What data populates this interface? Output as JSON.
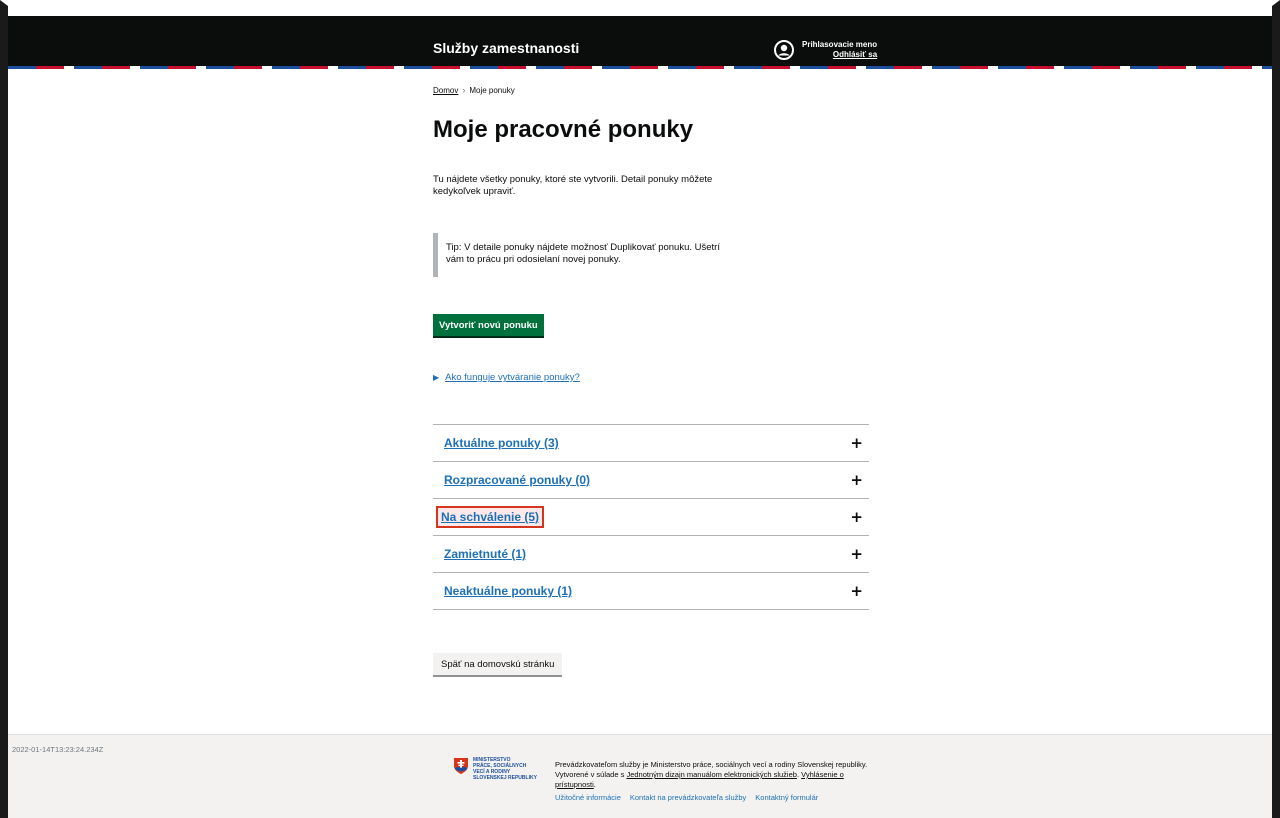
{
  "header": {
    "brand": "Služby zamestnanosti",
    "user_name": "Prihlasovacie meno",
    "logout": "Odhlásiť sa"
  },
  "breadcrumb": {
    "home": "Domov",
    "current": "Moje ponuky"
  },
  "main": {
    "title": "Moje pracovné ponuky",
    "intro": "Tu nájdete všetky ponuky, ktoré ste vytvorili. Detail ponuky môžete kedykoľvek upraviť.",
    "tip": "Tip: V detaile ponuky nájdete možnosť Duplikovať ponuku. Ušetrí vám to prácu pri odosielaní novej ponuky.",
    "create_button": "Vytvoriť novú ponuku",
    "details_link": "Ako funguje vytváranie ponuky?",
    "accordion": [
      {
        "label": "Aktuálne ponuky (3)",
        "highlighted": false
      },
      {
        "label": "Rozpracované ponuky (0)",
        "highlighted": false
      },
      {
        "label": "Na schválenie (5)",
        "highlighted": true
      },
      {
        "label": "Zamietnuté (1)",
        "highlighted": false
      },
      {
        "label": "Neaktuálne ponuky (1)",
        "highlighted": false
      }
    ],
    "back_button": "Späť na domovskú stránku"
  },
  "footer": {
    "timestamp": "2022-01-14T13:23:24.234Z",
    "ministry_lines": [
      "MINISTERSTVO",
      "PRÁCE, SOCIÁLNYCH",
      "VECÍ A RODINY",
      "SLOVENSKEJ REPUBLIKY"
    ],
    "operator_text": "Prevádzkovateľom služby je Ministerstvo práce, sociálnych vecí a rodiny Slovenskej republiky. Vytvorené v súlade s",
    "manual_link": "Jednotným dizajn manuálom elektronických služieb",
    "accessibility_link": "Vyhlásenie o prístupnosti",
    "links": [
      "Užitočné informácie",
      "Kontakt na prevádzkovateľa služby",
      "Kontaktný formulár"
    ]
  },
  "colors": {
    "header_bg": "#0b0c0c",
    "link": "#1d70b8",
    "primary_button": "#00703c",
    "highlight_border": "#d4351c"
  }
}
